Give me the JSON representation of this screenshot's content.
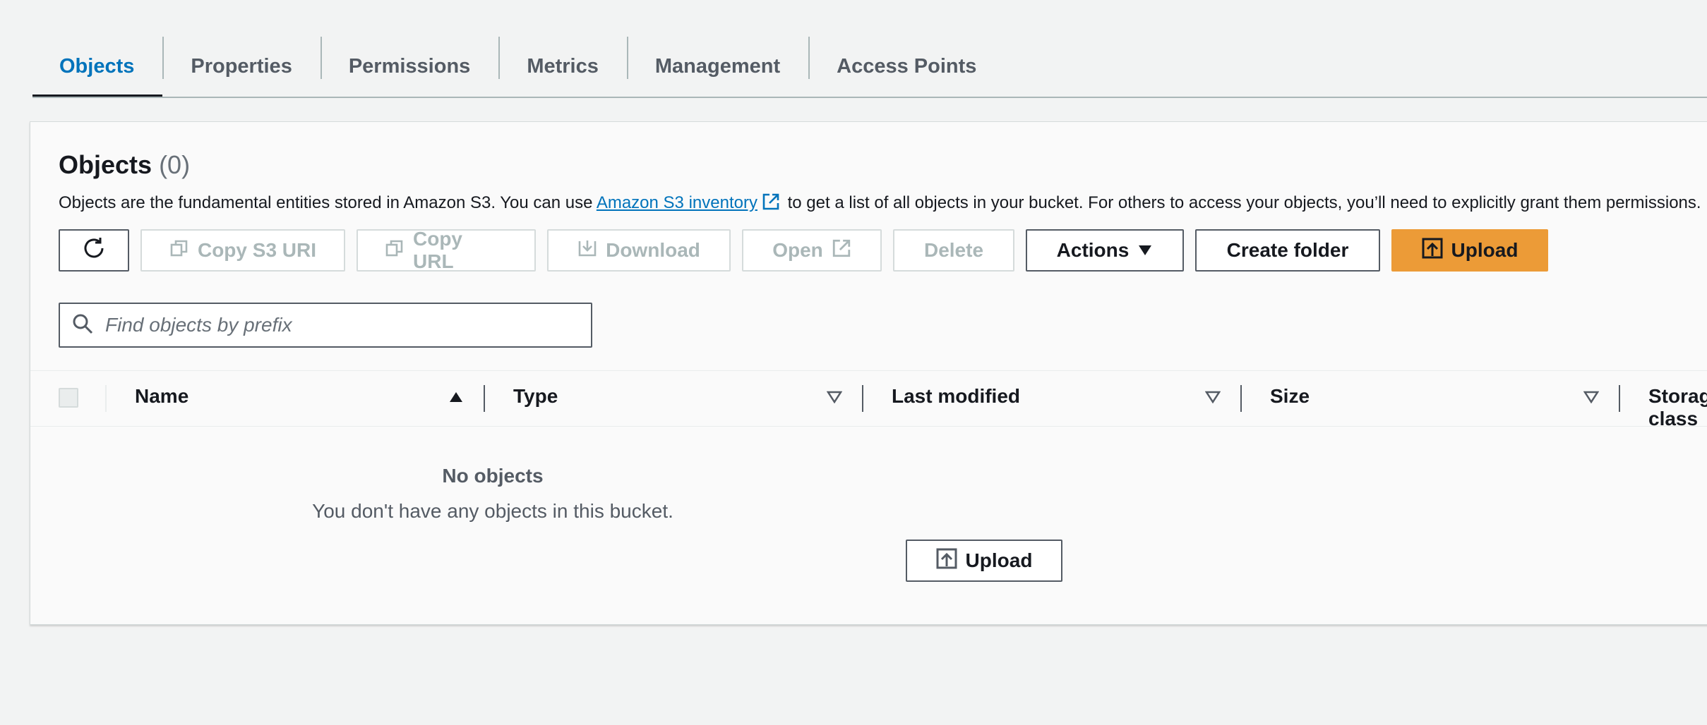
{
  "tabs": [
    {
      "label": "Objects",
      "active": true
    },
    {
      "label": "Properties"
    },
    {
      "label": "Permissions"
    },
    {
      "label": "Metrics"
    },
    {
      "label": "Management"
    },
    {
      "label": "Access Points"
    }
  ],
  "panel": {
    "title": "Objects",
    "count": "(0)",
    "description_before": "Objects are the fundamental entities stored in Amazon S3. You can use",
    "inventory_link": "Amazon S3 inventory",
    "description_after": "to get a list of all objects in your bucket. For others to access your objects, you’ll need to explicitly grant them permissions."
  },
  "toolbar": {
    "copy_s3_uri": "Copy S3 URI",
    "copy_url": "Copy URL",
    "download": "Download",
    "open": "Open",
    "delete": "Delete",
    "actions": "Actions",
    "create_folder": "Create folder",
    "upload": "Upload"
  },
  "search": {
    "placeholder": "Find objects by prefix"
  },
  "table": {
    "columns": [
      "Name",
      "Type",
      "Last modified",
      "Size",
      "Storage class"
    ]
  },
  "empty": {
    "title": "No objects",
    "message": "You don't have any objects in this bucket.",
    "upload": "Upload"
  },
  "colors": {
    "accent": "#0073bb",
    "primary_button": "#ec9b37"
  }
}
